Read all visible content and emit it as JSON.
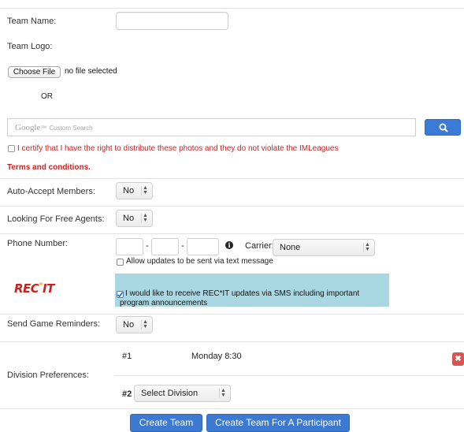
{
  "team_name": {
    "label": "Team Name:",
    "value": ""
  },
  "team_logo": {
    "label": "Team Logo:",
    "choose_file_label": "Choose File",
    "file_status": "no file selected",
    "or_label": "OR"
  },
  "search": {
    "brand": "Google",
    "brand_tm": "™",
    "placeholder_suffix": "Custom Search",
    "button_icon": "search-icon",
    "button_color": "#3a7bd5"
  },
  "certify": {
    "text": "I certify that I have the right to distribute these photos and they do not violate the IMLeagues",
    "checked": false,
    "color": "#cc2222"
  },
  "terms": {
    "text": "Terms and conditions."
  },
  "auto_accept": {
    "label": "Auto-Accept Members:",
    "value": "No"
  },
  "free_agents": {
    "label": "Looking For Free Agents:",
    "value": "No"
  },
  "phone": {
    "label": "Phone Number:",
    "dash": "-",
    "info_icon": "info-icon",
    "info_glyph": "i",
    "carrier_label": "Carrier:",
    "carrier_value": "None",
    "allow_text": "Allow updates to be sent via text message",
    "allow_checked": false
  },
  "recit": {
    "logo_text": "REC",
    "logo_star": "*",
    "logo_text2": "IT",
    "sms_text": "I would like to receive REC*IT updates via SMS including important program announcements",
    "sms_checked": true,
    "panel_color": "#a9d8e3"
  },
  "reminders": {
    "label": "Send Game Reminders:",
    "value": "No"
  },
  "division": {
    "label": "Division Preferences:",
    "pref1_num": "#1",
    "pref1_value": "Monday 8:30",
    "delete_icon": "close-icon",
    "delete_glyph": "✖",
    "pref2_num": "#2",
    "pref2_value": "Select Division"
  },
  "actions": {
    "create_team": "Create Team",
    "create_for_participant": "Create Team For A Participant",
    "button_color": "#3b7ad0"
  }
}
